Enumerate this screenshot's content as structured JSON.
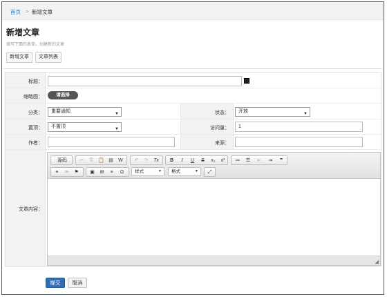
{
  "breadcrumb": {
    "home": "首页",
    "separator": ">",
    "current": "新增文章"
  },
  "page": {
    "title": "新增文章",
    "subtitle": "填写下面的表单，创建新的文章"
  },
  "tabs": [
    {
      "label": "新增文章"
    },
    {
      "label": "文章列表"
    }
  ],
  "form": {
    "title_label": "标题：",
    "title_value": "",
    "thumb_label": "缩略图：",
    "thumb_button": "请选择",
    "category_label": "分类：",
    "category_value": "重要通知",
    "status_label": "状态：",
    "status_value": "开放",
    "top_label": "置顶：",
    "top_value": "不置顶",
    "views_label": "访问量：",
    "views_value": "1",
    "author_label": "作者：",
    "author_value": "",
    "source_label": "来源：",
    "source_value": "",
    "content_label": "文章内容："
  },
  "editor": {
    "source_label": "源码",
    "style_label": "样式",
    "format_label": "格式",
    "tools": {
      "cut": "✂",
      "copy": "⎘",
      "paste": "📋",
      "paste_text": "▤",
      "paste_word": "W",
      "undo": "↶",
      "redo": "↷",
      "remove_format": "Tx",
      "bold": "B",
      "italic": "I",
      "underline": "U",
      "strike": "S",
      "subscript": "x₂",
      "superscript": "x²",
      "ordered_list": "≔",
      "bullet_list": "☰",
      "outdent": "⇤",
      "indent": "⇥",
      "quote": "❞",
      "link": "⚭",
      "unlink": "⚮",
      "anchor": "⚑",
      "image": "▣",
      "table": "⊞",
      "hr": "≡",
      "special_char": "Ω",
      "maximize": "⤢"
    }
  },
  "actions": {
    "submit": "提交",
    "cancel": "取消"
  },
  "colors": {
    "link": "#2a7ab0",
    "submit_bg": "#2f6fb7"
  }
}
